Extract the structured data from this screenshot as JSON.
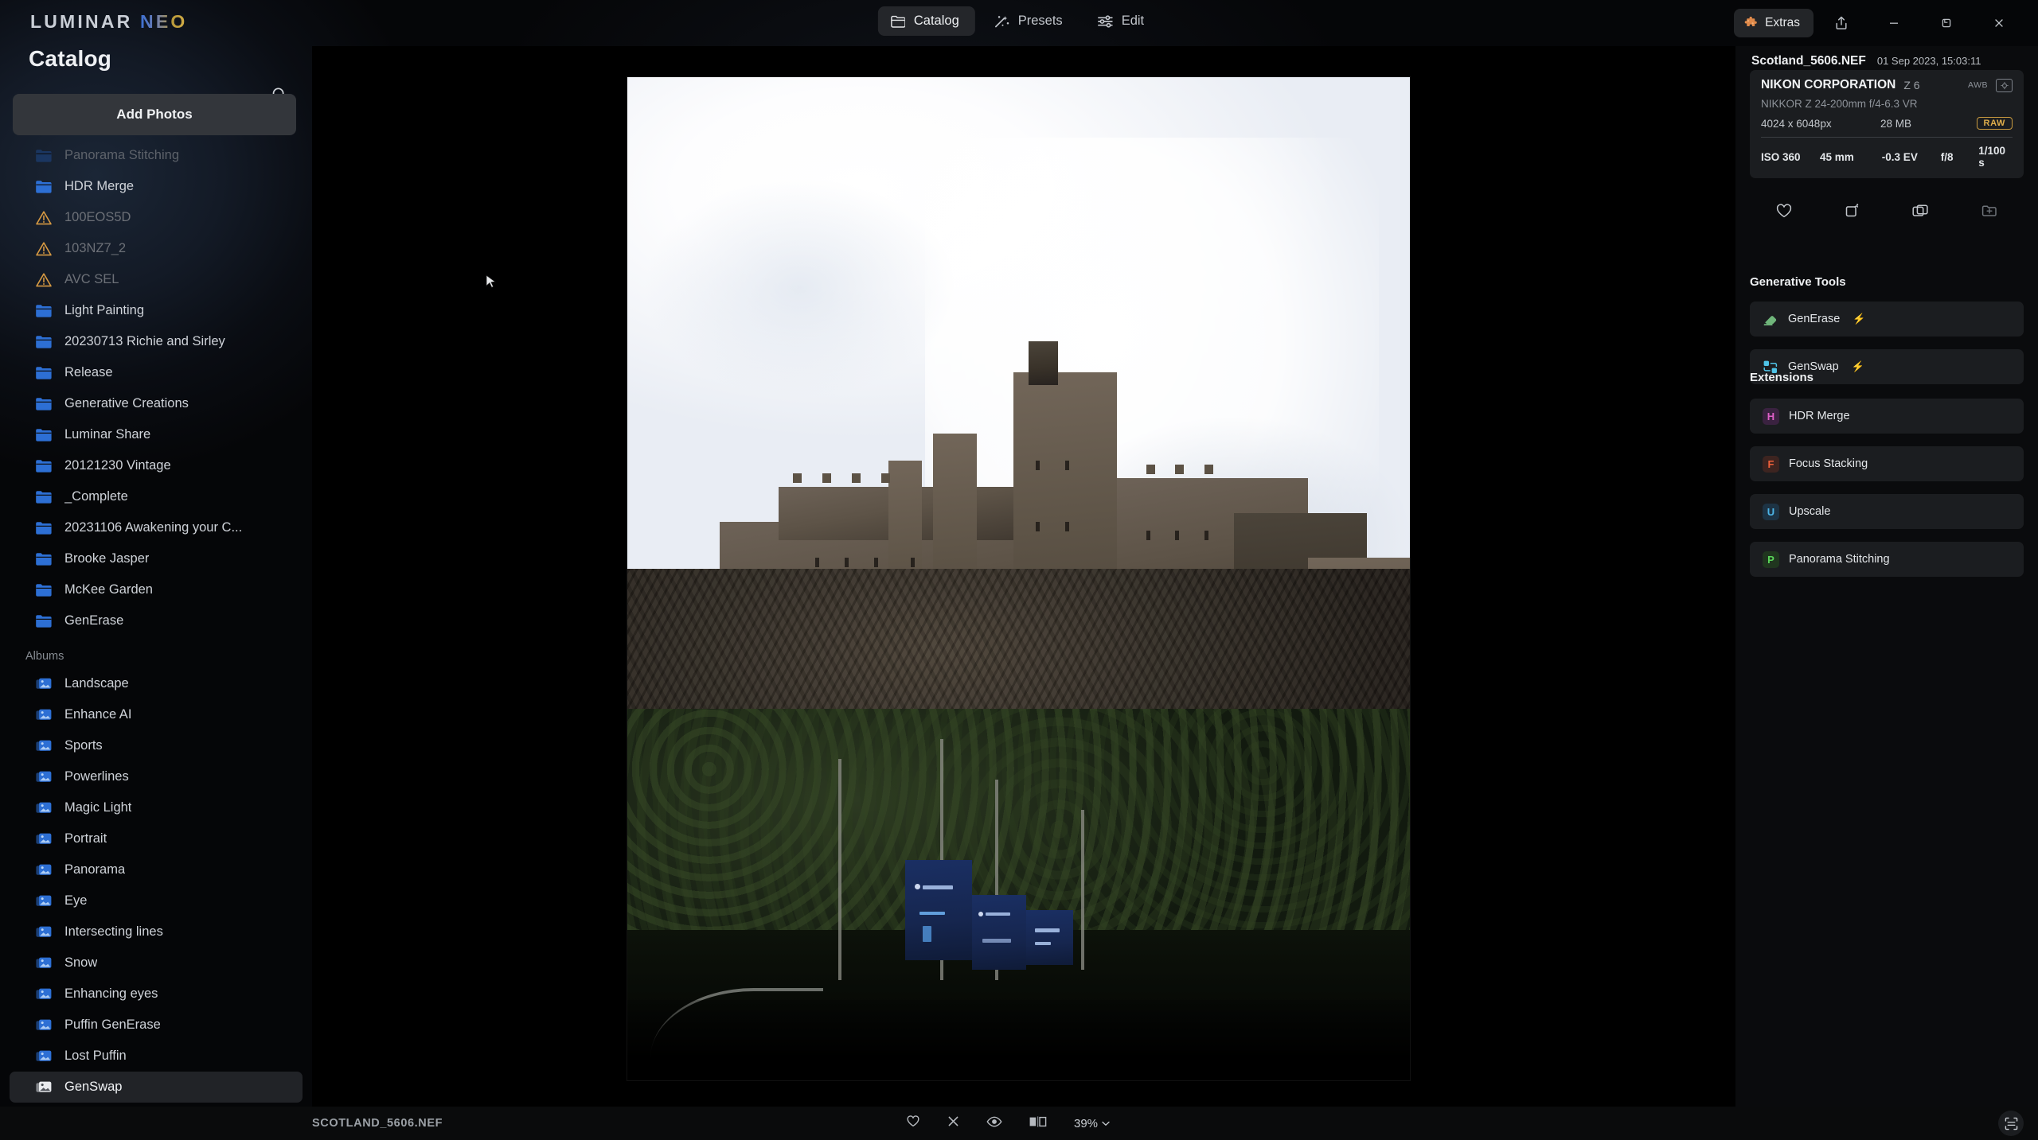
{
  "app": {
    "logo_primary": "LUMINAR",
    "logo_secondary": "NEO"
  },
  "titlebar": {
    "tabs": [
      {
        "label": "Catalog",
        "icon": "folder-icon",
        "active": true
      },
      {
        "label": "Presets",
        "icon": "sparkle-wand-icon",
        "active": false
      },
      {
        "label": "Edit",
        "icon": "sliders-icon",
        "active": false
      }
    ],
    "extras_label": "Extras",
    "extras_icon": "puzzle-piece-icon",
    "share_icon": "share-upload-icon",
    "minimize_icon": "minimize-icon",
    "maximize_icon": "restore-icon",
    "close_icon": "close-icon"
  },
  "sidebar": {
    "title": "Catalog",
    "search_icon": "search-icon",
    "add_photos_label": "Add Photos",
    "folders": [
      {
        "label": "Panorama Stitching",
        "icon": "folder-icon",
        "state": "clipped"
      },
      {
        "label": "HDR Merge",
        "icon": "folder-icon",
        "state": "normal"
      },
      {
        "label": "100EOS5D",
        "icon": "warning-icon",
        "state": "missing"
      },
      {
        "label": "103NZ7_2",
        "icon": "warning-icon",
        "state": "missing"
      },
      {
        "label": "AVC SEL",
        "icon": "warning-icon",
        "state": "missing"
      },
      {
        "label": "Light Painting",
        "icon": "folder-icon",
        "state": "normal"
      },
      {
        "label": "20230713 Richie and Sirley",
        "icon": "folder-icon",
        "state": "normal"
      },
      {
        "label": "Release",
        "icon": "folder-icon",
        "state": "normal"
      },
      {
        "label": "Generative Creations",
        "icon": "folder-icon",
        "state": "normal"
      },
      {
        "label": "Luminar Share",
        "icon": "folder-icon",
        "state": "normal"
      },
      {
        "label": "20121230 Vintage",
        "icon": "folder-icon",
        "state": "normal"
      },
      {
        "label": "_Complete",
        "icon": "folder-icon",
        "state": "normal"
      },
      {
        "label": "20231106 Awakening your C...",
        "icon": "folder-icon",
        "state": "normal"
      },
      {
        "label": "Brooke Jasper",
        "icon": "folder-icon",
        "state": "normal"
      },
      {
        "label": "McKee Garden",
        "icon": "folder-icon",
        "state": "normal"
      },
      {
        "label": "GenErase",
        "icon": "folder-icon",
        "state": "normal"
      }
    ],
    "albums_section_label": "Albums",
    "albums": [
      {
        "label": "Landscape",
        "icon": "album-icon",
        "selected": false
      },
      {
        "label": "Enhance AI",
        "icon": "album-icon",
        "selected": false
      },
      {
        "label": "Sports",
        "icon": "album-icon",
        "selected": false
      },
      {
        "label": "Powerlines",
        "icon": "album-icon",
        "selected": false
      },
      {
        "label": "Magic Light",
        "icon": "album-icon",
        "selected": false
      },
      {
        "label": "Portrait",
        "icon": "album-icon",
        "selected": false
      },
      {
        "label": "Panorama",
        "icon": "album-icon",
        "selected": false
      },
      {
        "label": "Eye",
        "icon": "album-icon",
        "selected": false
      },
      {
        "label": "Intersecting lines",
        "icon": "album-icon",
        "selected": false
      },
      {
        "label": "Snow",
        "icon": "album-icon",
        "selected": false
      },
      {
        "label": "Enhancing eyes",
        "icon": "album-icon",
        "selected": false
      },
      {
        "label": "Puffin GenErase",
        "icon": "album-icon",
        "selected": false
      },
      {
        "label": "Lost Puffin",
        "icon": "album-icon",
        "selected": false
      },
      {
        "label": "GenSwap",
        "icon": "album-icon",
        "selected": true
      }
    ]
  },
  "canvas": {
    "photo_alt": "Edinburgh Castle on castle rock under bright overcast sky"
  },
  "metadata": {
    "filename": "Scotland_5606.NEF",
    "datetime": "01 Sep 2023, 15:03:11",
    "camera_make": "NIKON CORPORATION",
    "camera_model": "Z 6",
    "white_balance": "AWB",
    "wb_icon_label": "wb-icon",
    "lens": "NIKKOR Z 24-200mm f/4-6.3 VR",
    "dimensions": "4024 x 6048px",
    "filesize": "28 MB",
    "format_badge": "RAW",
    "iso": "ISO 360",
    "focal_length": "45 mm",
    "exposure_comp": "-0.3 EV",
    "aperture": "f/8",
    "shutter": "1/100 s",
    "actions": [
      {
        "icon": "heart-icon",
        "name": "favorite-action"
      },
      {
        "icon": "reject-flag-icon",
        "name": "reject-action"
      },
      {
        "icon": "copies-icon",
        "name": "duplicate-action"
      },
      {
        "icon": "add-to-album-icon",
        "name": "add-to-album-action"
      }
    ]
  },
  "generative_tools": {
    "heading": "Generative Tools",
    "items": [
      {
        "label": "GenErase",
        "icon": "eraser-icon",
        "badge": "bolt-icon",
        "color": "#7fd18c"
      },
      {
        "label": "GenSwap",
        "icon": "swap-icon",
        "badge": "bolt-icon",
        "color": "#4fc4e8"
      }
    ]
  },
  "extensions": {
    "heading": "Extensions",
    "items": [
      {
        "label": "HDR Merge",
        "initial": "H",
        "color": "#e060c8",
        "bg": "#3a2240"
      },
      {
        "label": "Focus Stacking",
        "initial": "F",
        "color": "#f0603a",
        "bg": "#3d2420"
      },
      {
        "label": "Upscale",
        "initial": "U",
        "color": "#4db6e8",
        "bg": "#1d3344"
      },
      {
        "label": "Panorama Stitching",
        "initial": "P",
        "color": "#5ad65a",
        "bg": "#20361f"
      }
    ]
  },
  "statusbar": {
    "filename": "SCOTLAND_5606.NEF",
    "tools": [
      {
        "icon": "heart-icon",
        "name": "favorite-toggle"
      },
      {
        "icon": "reject-x-icon",
        "name": "reject-toggle"
      },
      {
        "icon": "eye-icon",
        "name": "preview-toggle"
      },
      {
        "icon": "compare-split-icon",
        "name": "compare-toggle"
      }
    ],
    "zoom_level": "39%",
    "zoom_chevron": "chevron-down-icon",
    "fit_icon": "fit-to-screen-icon"
  }
}
